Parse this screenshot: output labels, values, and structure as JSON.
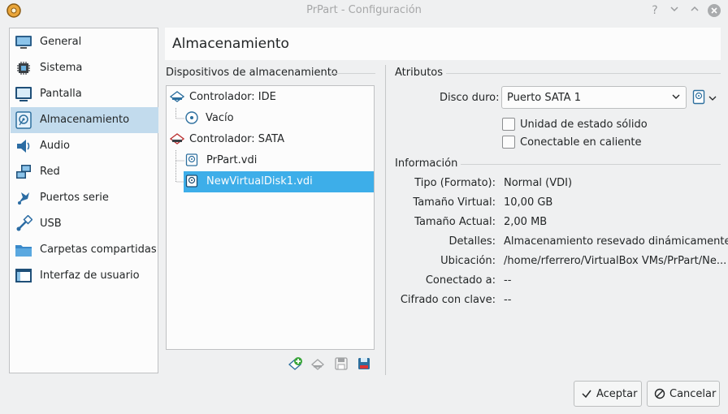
{
  "window": {
    "title": "PrPart - Configuración"
  },
  "sidebar": {
    "items": [
      {
        "label": "General",
        "icon": "monitor-icon"
      },
      {
        "label": "Sistema",
        "icon": "chip-icon"
      },
      {
        "label": "Pantalla",
        "icon": "display-icon"
      },
      {
        "label": "Almacenamiento",
        "icon": "disk-icon"
      },
      {
        "label": "Audio",
        "icon": "speaker-icon"
      },
      {
        "label": "Red",
        "icon": "network-icon"
      },
      {
        "label": "Puertos serie",
        "icon": "serial-port-icon"
      },
      {
        "label": "USB",
        "icon": "usb-icon"
      },
      {
        "label": "Carpetas compartidas",
        "icon": "folder-icon"
      },
      {
        "label": "Interfaz de usuario",
        "icon": "ui-icon"
      }
    ],
    "selected": "Almacenamiento"
  },
  "page": {
    "title": "Almacenamiento"
  },
  "storage": {
    "section_label": "Dispositivos de almacenamiento",
    "tree": {
      "ide_controller": "Controlador: IDE",
      "ide_children": [
        "Vacío"
      ],
      "sata_controller": "Controlador: SATA",
      "sata_children": [
        "PrPart.vdi",
        "NewVirtualDisk1.vdi"
      ],
      "selected": "NewVirtualDisk1.vdi"
    }
  },
  "attributes": {
    "section_label": "Atributos",
    "hard_disk_label": "Disco duro:",
    "hard_disk_value": "Puerto SATA 1",
    "ssd_label": "Unidad de estado sólido",
    "hotplug_label": "Conectable en caliente"
  },
  "information": {
    "section_label": "Información",
    "rows": [
      {
        "key": "Tipo (Formato):",
        "value": "Normal (VDI)"
      },
      {
        "key": "Tamaño Virtual:",
        "value": "10,00 GB"
      },
      {
        "key": "Tamaño Actual:",
        "value": "2,00 MB"
      },
      {
        "key": "Detalles:",
        "value": "Almacenamiento resevado dinámicamente"
      },
      {
        "key": "Ubicación:",
        "value": "/home/rferrero/VirtualBox VMs/PrPart/Ne..."
      },
      {
        "key": "Conectado a:",
        "value": "--"
      },
      {
        "key": "Cifrado con clave:",
        "value": "--"
      }
    ]
  },
  "buttons": {
    "ok": "Aceptar",
    "cancel": "Cancelar"
  },
  "colors": {
    "selection": "#3daee9",
    "sidebar_selection": "#c2dbed"
  }
}
